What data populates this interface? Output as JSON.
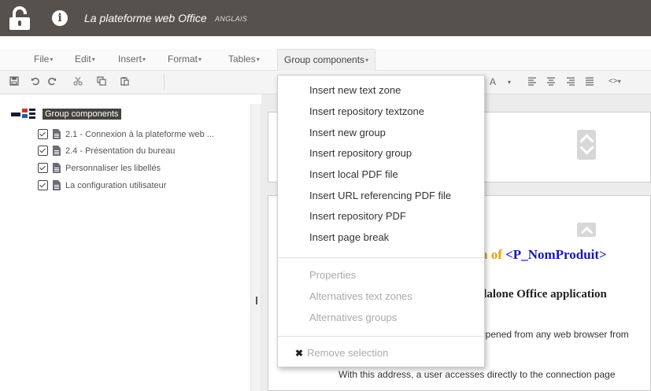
{
  "titlebar": {
    "app_title": "La plateforme web Office",
    "language": "ANGLAIS"
  },
  "menubar": {
    "items": [
      {
        "label": "File"
      },
      {
        "label": "Edit"
      },
      {
        "label": "Insert"
      },
      {
        "label": "Format"
      },
      {
        "label": "Tables"
      },
      {
        "label": "Group components"
      }
    ],
    "caret": "▾"
  },
  "toolbar": {
    "icons": [
      "save-icon",
      "undo-icon",
      "redo-icon",
      "cut-icon",
      "copy-icon",
      "paste-icon"
    ],
    "format_glyphs": {
      "font_color": "A",
      "caret": "▾",
      "code": "<>"
    }
  },
  "tree": {
    "root_label": "Group components",
    "items": [
      {
        "label": "2.1 - Connexion à la plateforme web ..."
      },
      {
        "label": "2.4 - Présentation du bureau"
      },
      {
        "label": "Personnaliser les libellés"
      },
      {
        "label": "La configuration utilisateur"
      }
    ]
  },
  "content": {
    "heading_partial": "n of ",
    "heading_tag": "<P_NomProduit>",
    "subheading_partial": "dalone Office application",
    "para1_partial": "opened from any web browser from",
    "para2": "With this address, a user accesses directly to the connection page"
  },
  "dropdown": {
    "items": [
      {
        "label": "Insert new text zone"
      },
      {
        "label": "Insert repository textzone"
      },
      {
        "label": "Insert new group"
      },
      {
        "label": "Insert repository group"
      },
      {
        "label": "Insert local PDF file"
      },
      {
        "label": "Insert URL referencing PDF file"
      },
      {
        "label": "Insert repository PDF"
      },
      {
        "label": "Insert page break"
      }
    ],
    "disabled_items": [
      {
        "label": "Properties"
      },
      {
        "label": "Alternatives text zones"
      },
      {
        "label": "Alternatives groups"
      }
    ],
    "remove_label": "Remove selection",
    "remove_glyph": "✖"
  }
}
